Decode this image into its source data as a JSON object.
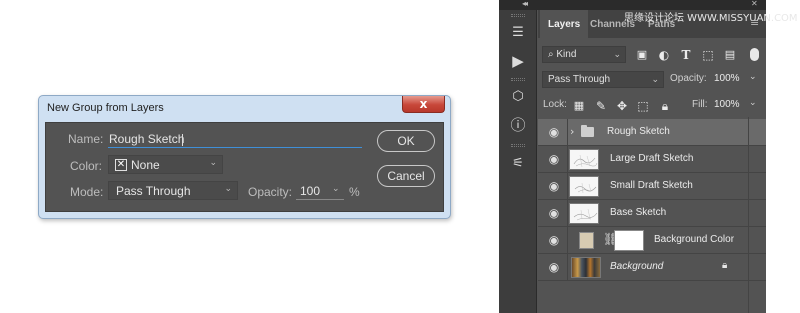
{
  "dialog": {
    "title": "New Group from Layers",
    "close_glyph": "x",
    "name_label": "Name:",
    "name_value": "Rough Sketch",
    "color_label": "Color:",
    "color_value": "None",
    "mode_label": "Mode:",
    "mode_value": "Pass Through",
    "opacity_label": "Opacity:",
    "opacity_value": "100",
    "opacity_unit": "%",
    "ok_label": "OK",
    "cancel_label": "Cancel"
  },
  "panel": {
    "collapse_glyph": "◂◂",
    "close_glyph": "✕",
    "tabs": [
      "Layers",
      "Channels",
      "Paths"
    ],
    "watermark": "思缘设计论坛 WWW.MISSYUAN.COM",
    "filter_value": "Kind",
    "blend_value": "Pass Through",
    "opacity_label": "Opacity:",
    "opacity_value": "100%",
    "lock_label": "Lock:",
    "fill_label": "Fill:",
    "fill_value": "100%",
    "layers": [
      {
        "name": "Rough Sketch",
        "kind": "group"
      },
      {
        "name": "Large Draft Sketch",
        "kind": "sketch"
      },
      {
        "name": "Small Draft Sketch",
        "kind": "sketch"
      },
      {
        "name": "Base Sketch",
        "kind": "sketch"
      },
      {
        "name": "Background Color",
        "kind": "fill"
      },
      {
        "name": "Background",
        "kind": "background"
      }
    ]
  }
}
